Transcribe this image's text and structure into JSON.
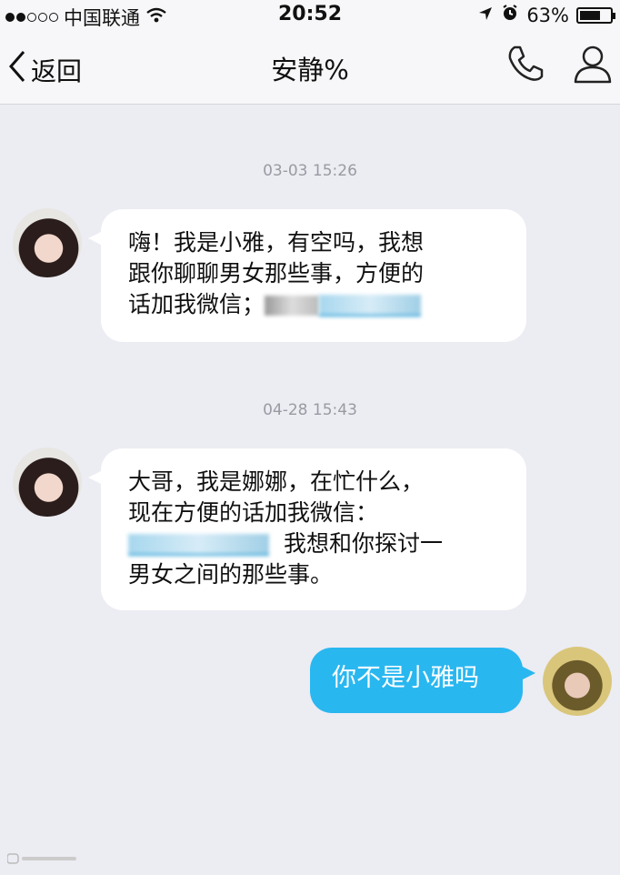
{
  "status_bar": {
    "carrier": "中国联通",
    "time": "20:52",
    "battery": "63%",
    "battery_level": 0.63
  },
  "nav": {
    "back_label": "返回",
    "title": "安静%"
  },
  "messages": [
    {
      "timestamp": "03-03 15:26",
      "sender": "other",
      "text_line1": "嗨！我是小雅，有空吗，我想",
      "text_line2": "跟你聊聊男女那些事，方便的",
      "text_line3": "话加我微信；"
    },
    {
      "timestamp": "04-28 15:43",
      "sender": "other",
      "text_line1": "大哥，我是娜娜，在忙什么，",
      "text_line2": "现在方便的话加我微信：",
      "text_line3": "我想和你探讨一",
      "text_line4": "男女之间的那些事。"
    },
    {
      "sender": "self",
      "text": "你不是小雅吗"
    }
  ],
  "icons": [
    "wifi-icon",
    "location-icon",
    "alarm-icon",
    "battery-icon",
    "back-chevron-icon",
    "phone-icon",
    "contact-icon"
  ],
  "colors": {
    "self_bubble": "#29b7f0",
    "background": "#ececf3"
  }
}
